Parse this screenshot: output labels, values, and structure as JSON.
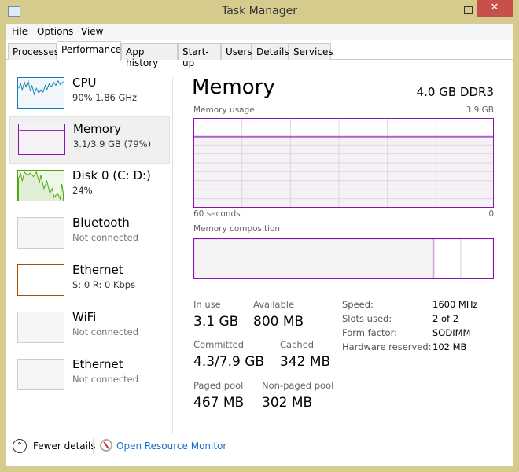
{
  "window": {
    "title": "Task Manager",
    "minimize": "–",
    "close": "✕"
  },
  "menu": [
    "File",
    "Options",
    "View"
  ],
  "tabs": [
    "Processes",
    "Performance",
    "App history",
    "Start-up",
    "Users",
    "Details",
    "Services"
  ],
  "active_tab": "Performance",
  "sidebar": [
    {
      "name": "CPU",
      "sub": "90%  1.86 GHz",
      "color": "#117dbb"
    },
    {
      "name": "Memory",
      "sub": "3.1/3.9 GB (79%)",
      "color": "#8b12ae",
      "selected": true
    },
    {
      "name": "Disk 0 (C: D:)",
      "sub": "24%",
      "color": "#4da60c"
    },
    {
      "name": "Bluetooth",
      "sub": "Not connected"
    },
    {
      "name": "Ethernet",
      "sub": "S: 0  R: 0 Kbps",
      "color": "#a74f01"
    },
    {
      "name": "WiFi",
      "sub": "Not connected"
    },
    {
      "name": "Ethernet",
      "sub": "Not connected"
    }
  ],
  "main": {
    "title": "Memory",
    "spec": "4.0 GB DDR3",
    "usage_label": "Memory usage",
    "usage_max": "3.9 GB",
    "time_left": "60 seconds",
    "time_right": "0",
    "usage_fraction": 0.79,
    "composition_label": "Memory composition",
    "composition": {
      "in_use": 0.8,
      "modified": 0.09
    },
    "stats": {
      "in_use_label": "In use",
      "in_use": "3.1 GB",
      "available_label": "Available",
      "available": "800 MB",
      "committed_label": "Committed",
      "committed": "4.3/7.9 GB",
      "cached_label": "Cached",
      "cached": "342 MB",
      "paged_label": "Paged pool",
      "paged": "467 MB",
      "nonpaged_label": "Non-paged pool",
      "nonpaged": "302 MB"
    },
    "details": [
      {
        "k": "Speed:",
        "v": "1600 MHz"
      },
      {
        "k": "Slots used:",
        "v": "2 of 2"
      },
      {
        "k": "Form factor:",
        "v": "SODIMM"
      },
      {
        "k": "Hardware reserved:",
        "v": "102 MB"
      }
    ]
  },
  "footer": {
    "fewer": "Fewer details",
    "monitor": "Open Resource Monitor"
  },
  "accent": "#8b12ae"
}
